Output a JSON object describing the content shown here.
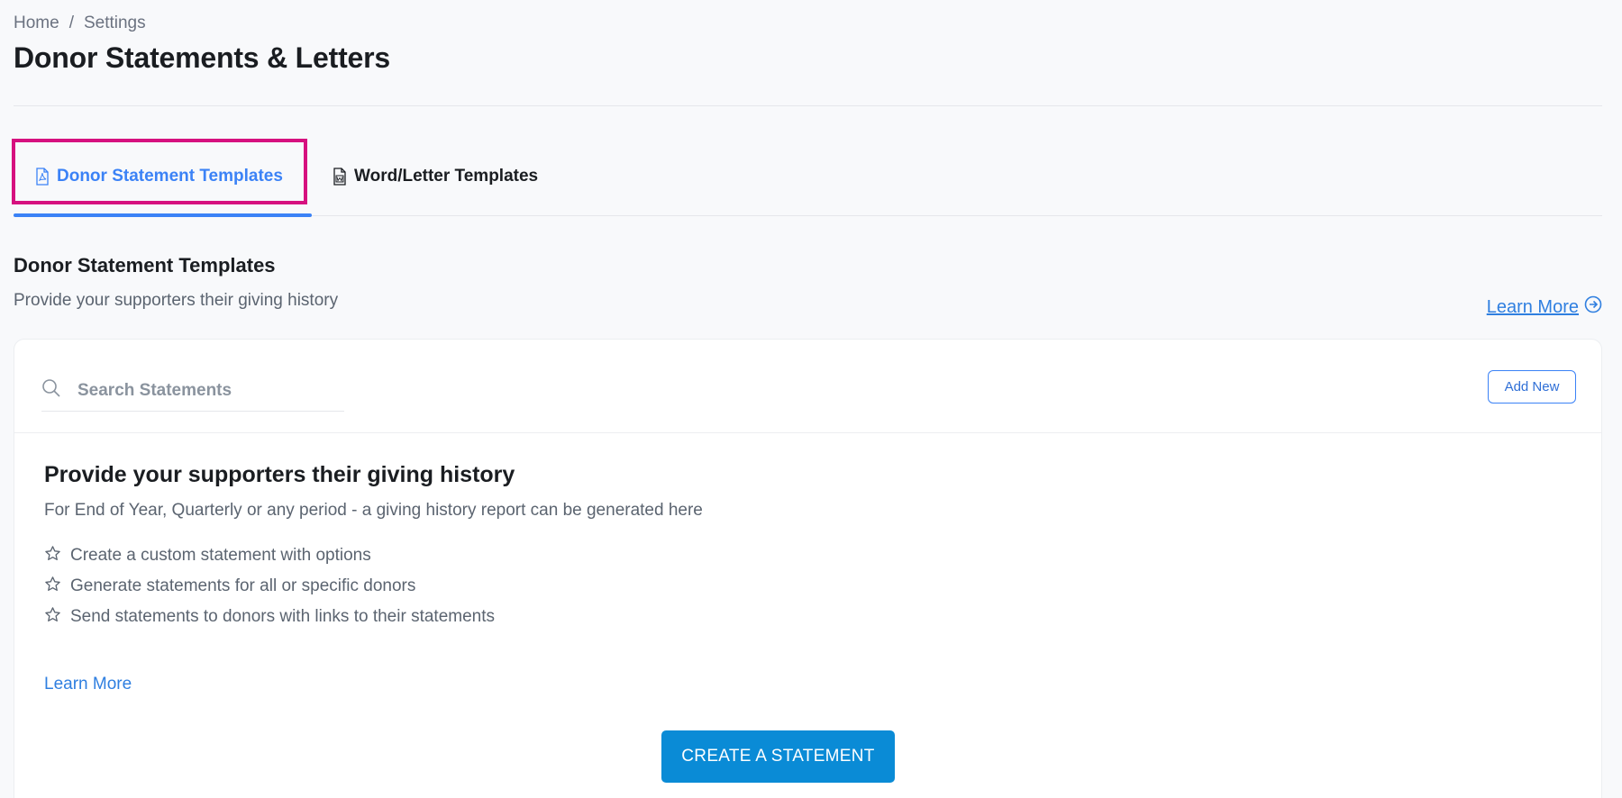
{
  "breadcrumb": {
    "home": "Home",
    "separator": "/",
    "current": "Settings"
  },
  "page_title": "Donor Statements & Letters",
  "tabs": [
    {
      "label": "Donor Statement Templates",
      "icon": "pdf-file-icon",
      "active": true
    },
    {
      "label": "Word/Letter Templates",
      "icon": "word-file-icon",
      "active": false
    }
  ],
  "section": {
    "title": "Donor Statement Templates",
    "subtitle": "Provide your supporters their giving history",
    "learn_more": "Learn More"
  },
  "card": {
    "search_placeholder": "Search Statements",
    "add_new": "Add New",
    "promo_title": "Provide your supporters their giving history",
    "promo_desc": "For End of Year, Quarterly or any period - a giving history report can be generated here",
    "features": [
      "Create a custom statement with options",
      "Generate statements for all or specific donors",
      "Send statements to donors with links to their statements"
    ],
    "learn_more": "Learn More",
    "create_button": "CREATE A STATEMENT"
  },
  "colors": {
    "accent": "#3b82f6",
    "highlight": "#d6117f",
    "primary_button": "#0a8bd6"
  }
}
